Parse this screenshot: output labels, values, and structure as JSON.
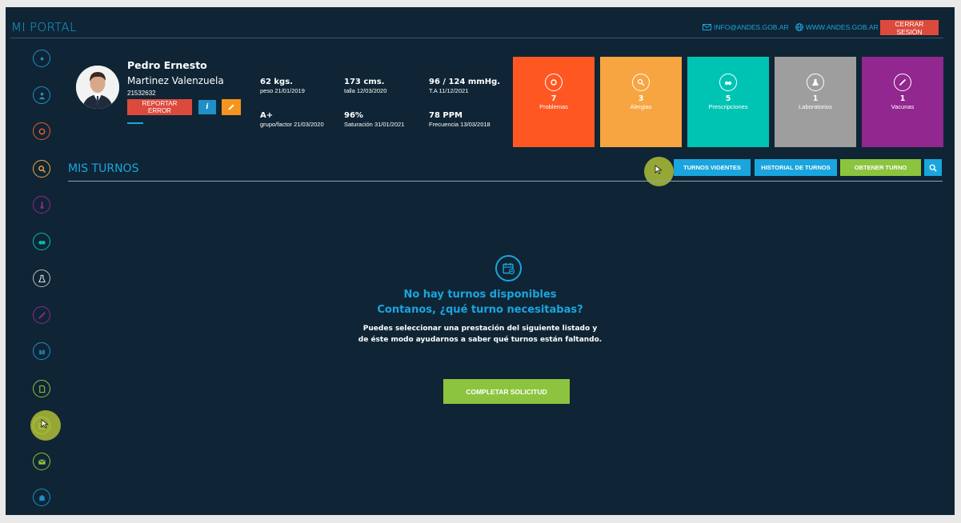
{
  "header": {
    "brand": "MI PORTAL",
    "email": "INFO@ANDES.GOB.AR",
    "website": "WWW.ANDES.GOB.AR",
    "logout_label": "CERRAR SESIÓN"
  },
  "sidebar": {
    "items": [
      {
        "name": "sidebar-item-home",
        "icon": "home-icon",
        "color": "#1e8fc9"
      },
      {
        "name": "sidebar-item-profile",
        "icon": "user-icon",
        "color": "#1e8fc9"
      },
      {
        "name": "sidebar-item-problems",
        "icon": "brain-icon",
        "color": "#f05a28"
      },
      {
        "name": "sidebar-item-allergies",
        "icon": "allergy-icon",
        "color": "#f7a541"
      },
      {
        "name": "sidebar-item-vitals",
        "icon": "thermometer-icon",
        "color": "#92278f"
      },
      {
        "name": "sidebar-item-prescriptions",
        "icon": "pills-icon",
        "color": "#00bfae"
      },
      {
        "name": "sidebar-item-laboratories",
        "icon": "flask-icon",
        "color": "#bdbdbd"
      },
      {
        "name": "sidebar-item-vaccines",
        "icon": "syringe-icon",
        "color": "#92278f"
      },
      {
        "name": "sidebar-item-family",
        "icon": "family-icon",
        "color": "#1e8fc9"
      },
      {
        "name": "sidebar-item-documents",
        "icon": "document-icon",
        "color": "#8cc43f"
      },
      {
        "name": "sidebar-item-appointments",
        "icon": "calendar-icon",
        "color": "#8cc43f"
      },
      {
        "name": "sidebar-item-messages",
        "icon": "mail-icon",
        "color": "#8cc43f"
      },
      {
        "name": "sidebar-item-institutions",
        "icon": "building-icon",
        "color": "#1e8fc9"
      }
    ]
  },
  "patient": {
    "first_name": "Pedro Ernesto",
    "last_name": "Martinez Valenzuela",
    "document": "21532632",
    "report_error_label": "REPORTAR ERROR",
    "info_label": "i"
  },
  "vitals": [
    {
      "value": "62 kgs.",
      "label": "peso 21/01/2019"
    },
    {
      "value": "173 cms.",
      "label": "talla 12/03/2020"
    },
    {
      "value": "96 / 124 mmHg.",
      "label": "T.A 11/12/2021"
    },
    {
      "value": "A+",
      "label": "grupo/factor 21/03/2020"
    },
    {
      "value": "96%",
      "label": "Saturación 31/01/2021"
    },
    {
      "value": "78 PPM",
      "label": "Frecuencia 13/03/2018"
    }
  ],
  "tiles": [
    {
      "count": "7",
      "label": "Problemas",
      "color": "#ff5722",
      "icon": "brain-icon"
    },
    {
      "count": "3",
      "label": "Alergias",
      "color": "#f7a541",
      "icon": "allergy-icon"
    },
    {
      "count": "5",
      "label": "Prescripciones",
      "color": "#00c4b3",
      "icon": "pills-icon"
    },
    {
      "count": "1",
      "label": "Laboratorios",
      "color": "#9e9e9e",
      "icon": "flask-icon"
    },
    {
      "count": "1",
      "label": "Vacunas",
      "color": "#92278f",
      "icon": "syringe-icon"
    }
  ],
  "turnos": {
    "title": "MIS TURNOS",
    "tab_vigentes": "TURNOS VIGENTES",
    "tab_historial": "HISTORIAL DE TURNOS",
    "tab_obtener": "OBTENER TURNO"
  },
  "empty_state": {
    "title_line1": "No hay turnos disponibles",
    "title_line2": "Contanos, ¿qué turno necesitabas?",
    "text_line1": "Puedes seleccionar una prestación del siguiente listado y",
    "text_line2": "de éste modo ayudarnos a saber qué turnos están faltando.",
    "button_label": "COMPLETAR SOLICITUD"
  }
}
